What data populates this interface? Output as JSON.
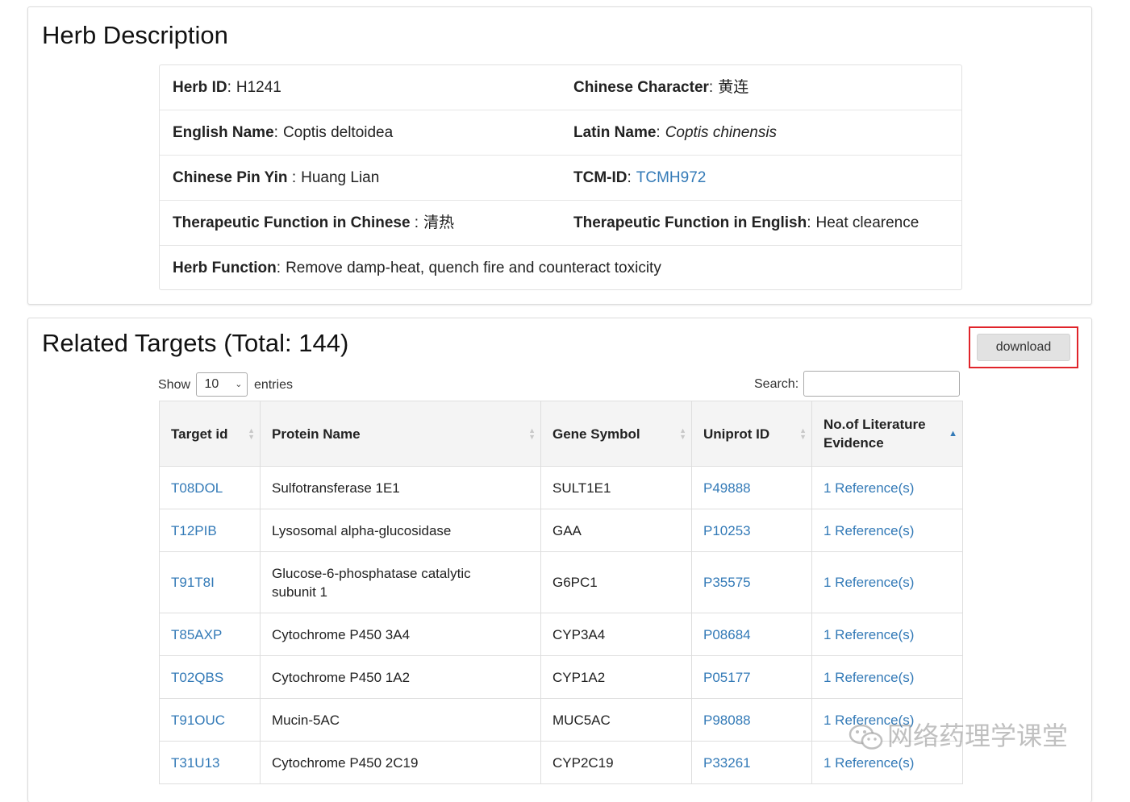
{
  "herb_section": {
    "title": "Herb Description",
    "rows": [
      [
        {
          "label": "Herb ID",
          "sep": ":",
          "value": "H1241",
          "style": "plain"
        },
        {
          "label": "Chinese Character",
          "sep": ":",
          "value": "黄连",
          "style": "plain"
        }
      ],
      [
        {
          "label": "English Name",
          "sep": ":",
          "value": "Coptis deltoidea",
          "style": "plain"
        },
        {
          "label": "Latin Name",
          "sep": ":",
          "value": "Coptis chinensis",
          "style": "italic"
        }
      ],
      [
        {
          "label": "Chinese Pin Yin",
          "sep": " :",
          "value": "Huang Lian",
          "style": "plain"
        },
        {
          "label": "TCM-ID",
          "sep": ":",
          "value": "TCMH972",
          "style": "link"
        }
      ],
      [
        {
          "label": "Therapeutic Function in Chinese",
          "sep": " :",
          "value": "清热",
          "style": "plain"
        },
        {
          "label": "Therapeutic Function in English",
          "sep": ":",
          "value": "Heat clearence",
          "style": "plain"
        }
      ],
      [
        {
          "label": "Herb Function",
          "sep": ":",
          "value": "Remove damp-heat, quench fire and counteract toxicity",
          "style": "plain"
        }
      ]
    ]
  },
  "targets_section": {
    "title": "Related Targets",
    "total": "(Total: 144)",
    "download_label": "download",
    "length": {
      "show_label": "Show",
      "value": "10",
      "entries_label": "entries"
    },
    "search": {
      "label": "Search:",
      "value": ""
    },
    "columns": [
      {
        "label": "Target id",
        "sort": "both"
      },
      {
        "label": "Protein Name",
        "sort": "both"
      },
      {
        "label": "Gene Symbol",
        "sort": "both"
      },
      {
        "label": "Uniprot ID",
        "sort": "both"
      },
      {
        "label": "No.of Literature Evidence",
        "sort": "asc"
      }
    ],
    "rows": [
      {
        "target_id": "T08DOL",
        "protein": "Sulfotransferase 1E1",
        "gene": "SULT1E1",
        "uniprot": "P49888",
        "refs": "1 Reference(s)"
      },
      {
        "target_id": "T12PIB",
        "protein": "Lysosomal alpha-glucosidase",
        "gene": "GAA",
        "uniprot": "P10253",
        "refs": "1 Reference(s)"
      },
      {
        "target_id": "T91T8I",
        "protein": "Glucose-6-phosphatase catalytic subunit 1",
        "gene": "G6PC1",
        "uniprot": "P35575",
        "refs": "1 Reference(s)"
      },
      {
        "target_id": "T85AXP",
        "protein": "Cytochrome P450 3A4",
        "gene": "CYP3A4",
        "uniprot": "P08684",
        "refs": "1 Reference(s)"
      },
      {
        "target_id": "T02QBS",
        "protein": "Cytochrome P450 1A2",
        "gene": "CYP1A2",
        "uniprot": "P05177",
        "refs": "1 Reference(s)"
      },
      {
        "target_id": "T91OUC",
        "protein": "Mucin-5AC",
        "gene": "MUC5AC",
        "uniprot": "P98088",
        "refs": "1 Reference(s)"
      },
      {
        "target_id": "T31U13",
        "protein": "Cytochrome P450 2C19",
        "gene": "CYP2C19",
        "uniprot": "P33261",
        "refs": "1 Reference(s)"
      }
    ]
  },
  "watermark": {
    "text": "网络药理学课堂",
    "icon": "wechat-icon"
  },
  "colors": {
    "link": "#337ab7",
    "highlight_frame": "#e0242a",
    "header_bg": "#f4f4f4"
  }
}
